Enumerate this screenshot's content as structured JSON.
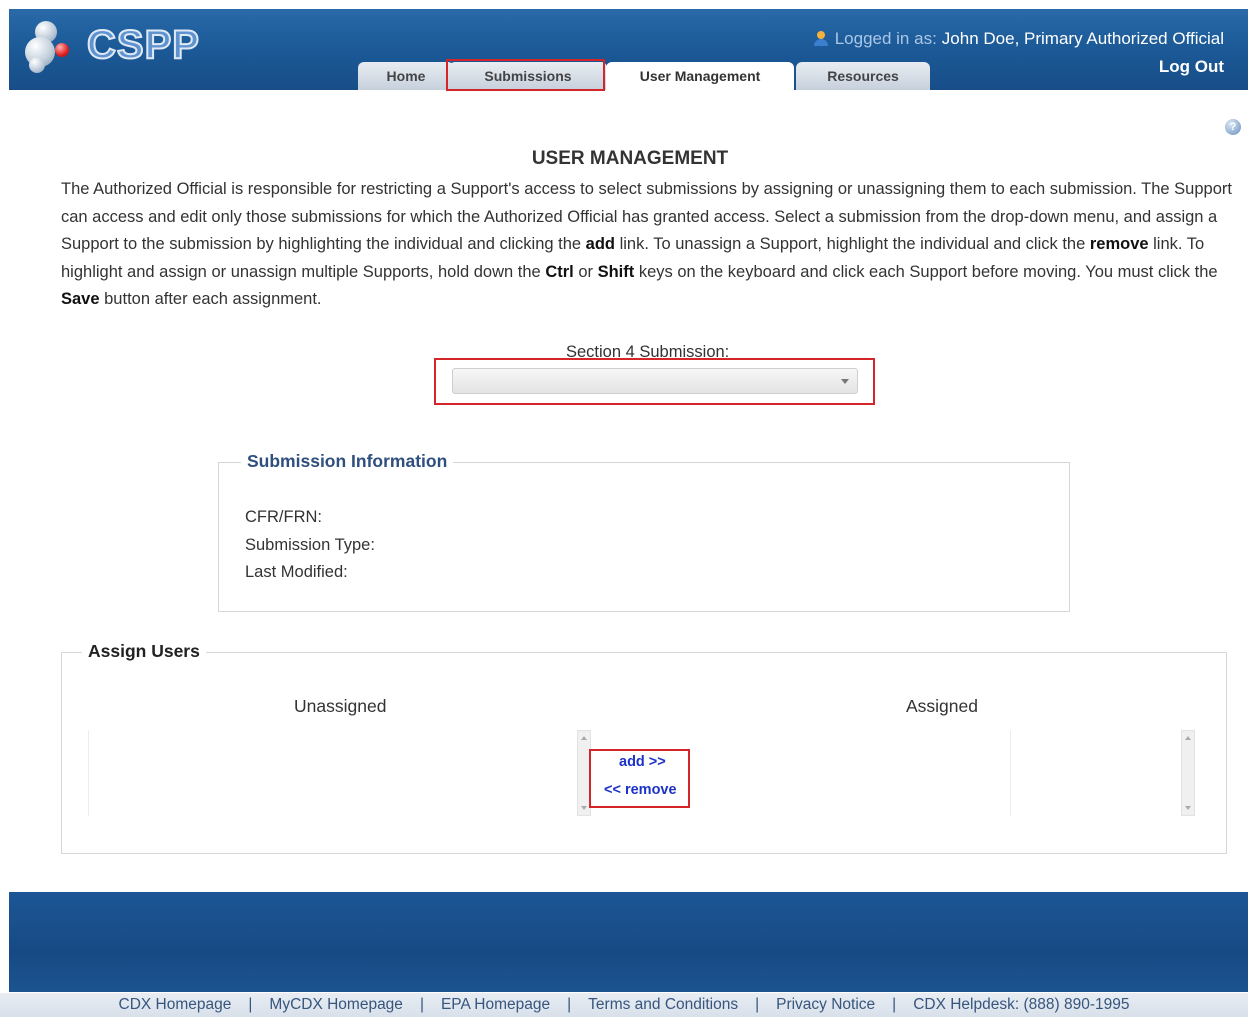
{
  "app": {
    "logo_text": "CSPP"
  },
  "header": {
    "logged_in_label": "Logged in as:",
    "user_name": "John Doe, Primary Authorized Official",
    "logout": "Log Out"
  },
  "tabs": [
    {
      "label": "Home"
    },
    {
      "label": "Submissions"
    },
    {
      "label": "User Management",
      "active": true
    },
    {
      "label": "Resources"
    }
  ],
  "main": {
    "title": "USER MANAGEMENT",
    "intro": {
      "p1": "The Authorized Official is responsible for restricting a Support's access to select submissions by assigning or unassigning them to each submission. The Support can access and edit only those submissions for which the Authorized Official has granted access. Select a submission from the drop-down menu, and assign a Support to the submission by highlighting the individual and clicking the ",
      "b1": "add",
      "p2": " link. To unassign a Support, highlight the individual and click the ",
      "b2": "remove",
      "p3": " link. To highlight and assign or unassign multiple Supports, hold down the ",
      "b3": "Ctrl",
      "p4": " or ",
      "b4": "Shift",
      "p5": " keys on the keyboard and click each Support before moving. You must click the ",
      "b5": "Save",
      "p6": " button after each assignment."
    },
    "submission_select": {
      "label": "Section 4 Submission:",
      "value": ""
    },
    "submission_info": {
      "legend": "Submission Information",
      "cfr_label": "CFR/FRN:",
      "type_label": "Submission Type:",
      "modified_label": "Last Modified:"
    },
    "assign_users": {
      "legend": "Assign Users",
      "unassigned_label": "Unassigned",
      "assigned_label": "Assigned",
      "add_link": "add >>",
      "remove_link": "<< remove"
    }
  },
  "footer": {
    "links": [
      "CDX Homepage",
      "MyCDX Homepage",
      "EPA Homepage",
      "Terms and Conditions",
      "Privacy Notice",
      "CDX Helpdesk: (888) 890-1995"
    ],
    "separator": "|"
  },
  "colors": {
    "header_blue": "#1c5a98",
    "highlight_red": "#d4262a",
    "link_blue": "#1d32c8",
    "legend_blue": "#2f4f7f"
  }
}
